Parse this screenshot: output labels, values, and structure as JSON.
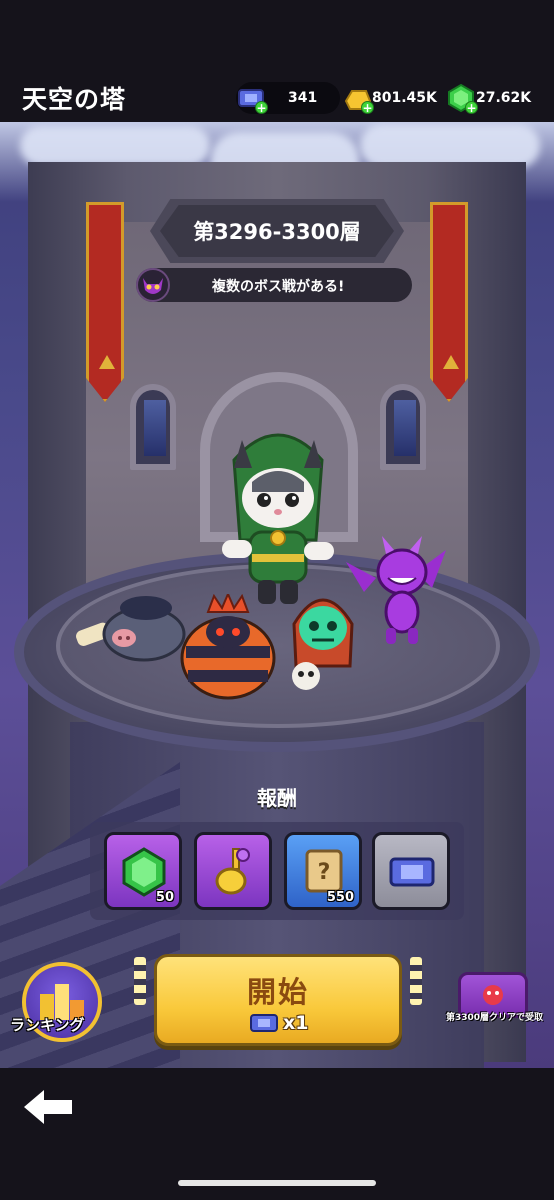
{
  "header": {
    "title": "天空の塔",
    "tickets": "341",
    "gold": "801.45K",
    "gems": "27.62K"
  },
  "tower": {
    "floor_label": "第3296-3300層",
    "notice": "複数のボス戦がある!"
  },
  "rewards": {
    "title": "報酬",
    "items": [
      {
        "icon": "green-gem-icon",
        "qty": "50"
      },
      {
        "icon": "golden-key-icon",
        "qty": ""
      },
      {
        "icon": "mystery-scroll-icon",
        "qty": "550"
      },
      {
        "icon": "ticket-icon",
        "qty": ""
      }
    ]
  },
  "actions": {
    "start_label": "開始",
    "start_cost": "x1",
    "ranking_label": "ランキング",
    "chest_label": "第3300層クリアで受取"
  },
  "colors": {
    "accent_gold": "#f9c93b",
    "gem_green": "#3fd43a",
    "banner_red": "#b32a22"
  }
}
